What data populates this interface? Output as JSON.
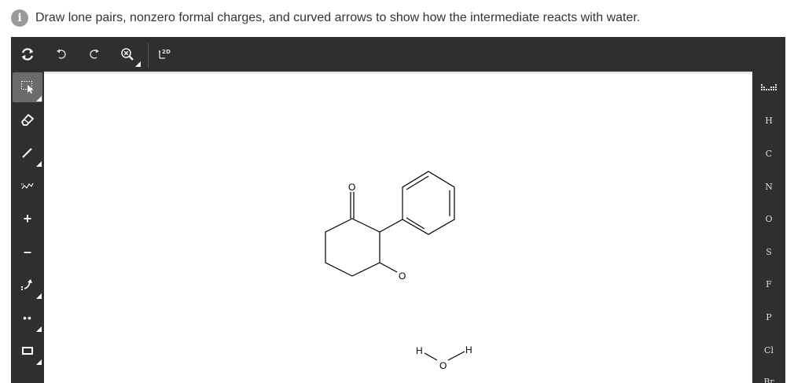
{
  "prompt": {
    "icon": "info-icon",
    "info_glyph": "i",
    "text": "Draw lone pairs, nonzero formal charges, and curved arrows to show how the intermediate reacts with water."
  },
  "toolbar": {
    "items": [
      {
        "name": "reset-icon"
      },
      {
        "name": "undo-icon"
      },
      {
        "name": "redo-icon"
      },
      {
        "name": "zoom-reset-icon"
      },
      {
        "name": "2d-clean-icon"
      }
    ],
    "label_2d": "2D"
  },
  "left_tools": [
    {
      "name": "select-tool-icon",
      "active": true
    },
    {
      "name": "eraser-tool-icon"
    },
    {
      "name": "bond-tool-icon"
    },
    {
      "name": "chain-tool-icon"
    },
    {
      "name": "plus-charge-icon",
      "glyph": "+"
    },
    {
      "name": "minus-charge-icon",
      "glyph": "–"
    },
    {
      "name": "curved-arrow-tool-icon"
    },
    {
      "name": "lone-pair-tool-icon",
      "glyph": "••"
    },
    {
      "name": "ring-tool-icon"
    }
  ],
  "elements": [
    "H",
    "C",
    "N",
    "O",
    "S",
    "F",
    "P",
    "Cl",
    "Br"
  ],
  "canvas": {
    "atoms": {
      "ketone_o": "O",
      "alkoxide_o": "O",
      "water_h1": "H",
      "water_o": "O",
      "water_h2": "H"
    }
  },
  "colors": {
    "toolbar_bg": "#2f2f2f",
    "active_tool": "#6b6b6b",
    "info_icon": "#9a9a9a",
    "bond": "#000000"
  }
}
